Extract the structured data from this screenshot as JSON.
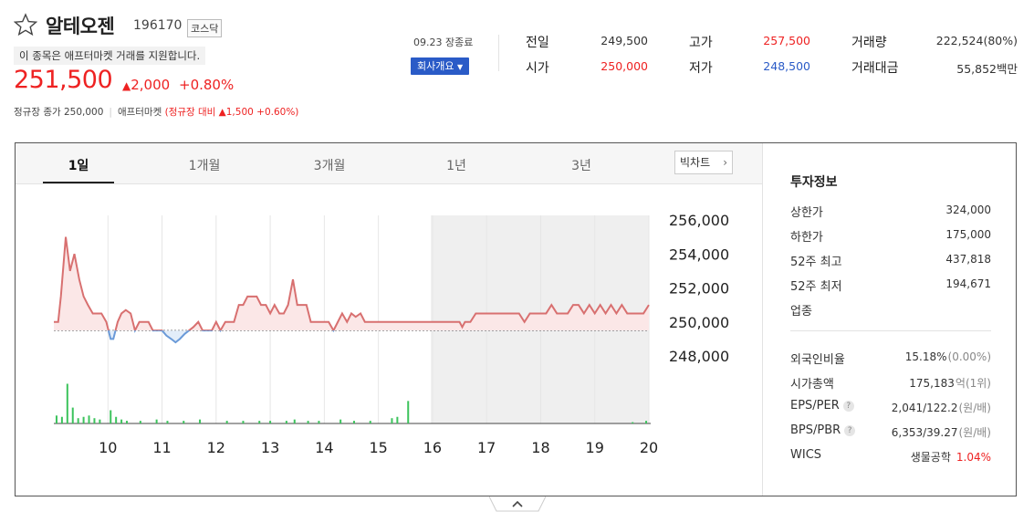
{
  "stock": {
    "name": "알테오젠",
    "code": "196170",
    "market": "코스닥",
    "notice": "이 종목은 애프터마켓 거래를 지원합니다.",
    "price": "251,500",
    "change_amount": "2,000",
    "change_percent": "+0.80%",
    "regular_close_label": "정규장 종가 250,000",
    "aftermarket_label": "애프터마켓",
    "aftermarket_compare": "(정규장 대비 ▲1,500 +0.60%)"
  },
  "header": {
    "date_status": "09.23 장종료",
    "company_button": "회사개요",
    "stats": [
      {
        "label": "전일",
        "value": "249,500",
        "tone": "normal"
      },
      {
        "label": "고가",
        "value": "257,500",
        "tone": "up"
      },
      {
        "label": "거래량",
        "value": "222,524(80%)",
        "tone": "normal"
      },
      {
        "label": "시가",
        "value": "250,000",
        "tone": "up"
      },
      {
        "label": "저가",
        "value": "248,500",
        "tone": "down"
      },
      {
        "label": "거래대금",
        "value": "55,852백만",
        "tone": "normal"
      }
    ]
  },
  "tabs": [
    {
      "label": "1일",
      "active": true
    },
    {
      "label": "1개월",
      "active": false
    },
    {
      "label": "3개월",
      "active": false
    },
    {
      "label": "1년",
      "active": false
    },
    {
      "label": "3년",
      "active": false
    }
  ],
  "big_chart_button": "빅차트",
  "chart_data": {
    "type": "line",
    "title": "",
    "x_ticks": [
      "10",
      "11",
      "12",
      "13",
      "14",
      "15",
      "16",
      "17",
      "18",
      "19",
      "20"
    ],
    "y_ticks": [
      "256,000",
      "254,000",
      "252,000",
      "250,000",
      "248,000"
    ],
    "ylim": [
      247500,
      257000
    ],
    "baseline": 249500,
    "shaded_from_hour": 15.97,
    "series": [
      {
        "hours": [
          9.0,
          9.08,
          9.13,
          9.22,
          9.3,
          9.38,
          9.47,
          9.55,
          9.63,
          9.72,
          9.8,
          9.88,
          9.97,
          10.05,
          10.1,
          10.18,
          10.25,
          10.33,
          10.42,
          10.5,
          10.58,
          10.67,
          10.75,
          10.83,
          10.92,
          11.0,
          11.08,
          11.17,
          11.25,
          11.33,
          11.42,
          11.5,
          11.58,
          11.67,
          11.75,
          11.83,
          11.92,
          12.0,
          12.08,
          12.17,
          12.25,
          12.33,
          12.42,
          12.5,
          12.58,
          12.67,
          12.75,
          12.83,
          12.92,
          13.0,
          13.08,
          13.17,
          13.25,
          13.33,
          13.42,
          13.5,
          13.58,
          13.67,
          13.75,
          13.83,
          13.92,
          14.0,
          14.08,
          14.17,
          14.25,
          14.33,
          14.42,
          14.5,
          14.58,
          14.67,
          14.75,
          14.83,
          14.92,
          15.0,
          15.08,
          15.17,
          15.25,
          15.33,
          15.42,
          15.5,
          15.58,
          15.67,
          15.75,
          15.83,
          15.92,
          16.0,
          16.1,
          16.2,
          16.3,
          16.4,
          16.5,
          16.55,
          16.6,
          16.7,
          16.8,
          16.9,
          17.0,
          17.1,
          17.2,
          17.3,
          17.4,
          17.5,
          17.6,
          17.7,
          17.8,
          17.9,
          18.0,
          18.1,
          18.2,
          18.3,
          18.4,
          18.5,
          18.6,
          18.7,
          18.8,
          18.9,
          19.0,
          19.1,
          19.2,
          19.3,
          19.4,
          19.5,
          19.6,
          19.7,
          19.8,
          19.9,
          20.0
        ],
        "values": [
          250000,
          250000,
          251500,
          255000,
          253000,
          254000,
          252500,
          251500,
          251000,
          250500,
          250500,
          250500,
          250000,
          249000,
          249000,
          250000,
          250500,
          250700,
          250500,
          249500,
          250000,
          250000,
          250000,
          249500,
          249500,
          249500,
          249200,
          249000,
          248800,
          249000,
          249300,
          249500,
          249700,
          250000,
          249500,
          249500,
          249500,
          250000,
          249500,
          250000,
          250000,
          250000,
          251000,
          251000,
          251500,
          251500,
          251500,
          251000,
          251000,
          250500,
          251000,
          250500,
          250500,
          251000,
          252500,
          251000,
          251000,
          251000,
          250000,
          250000,
          250000,
          250000,
          250000,
          249500,
          250000,
          250500,
          250000,
          250500,
          250300,
          250500,
          250000,
          250000,
          250000,
          250000,
          250000,
          250000,
          250000,
          250000,
          250000,
          250000,
          250000,
          250000,
          250000,
          250000,
          250000,
          250000,
          250000,
          250000,
          250000,
          250000,
          250000,
          249700,
          250000,
          250000,
          250500,
          250500,
          250500,
          250500,
          250500,
          250500,
          250500,
          250500,
          250500,
          250000,
          250500,
          250500,
          250500,
          250500,
          251000,
          250500,
          250500,
          250500,
          251000,
          251000,
          250500,
          251000,
          250500,
          251000,
          250500,
          251000,
          250500,
          251000,
          250500,
          250500,
          250500,
          250500,
          251000,
          250500,
          251500,
          251500
        ]
      }
    ],
    "volume": [
      {
        "hour": 9.05,
        "v": 6
      },
      {
        "hour": 9.15,
        "v": 5
      },
      {
        "hour": 9.25,
        "v": 30
      },
      {
        "hour": 9.35,
        "v": 12
      },
      {
        "hour": 9.45,
        "v": 4
      },
      {
        "hour": 9.55,
        "v": 5
      },
      {
        "hour": 9.65,
        "v": 6
      },
      {
        "hour": 9.75,
        "v": 4
      },
      {
        "hour": 9.85,
        "v": 3
      },
      {
        "hour": 10.05,
        "v": 10
      },
      {
        "hour": 10.15,
        "v": 5
      },
      {
        "hour": 10.25,
        "v": 3
      },
      {
        "hour": 10.35,
        "v": 2
      },
      {
        "hour": 10.6,
        "v": 2
      },
      {
        "hour": 10.9,
        "v": 3
      },
      {
        "hour": 11.1,
        "v": 2
      },
      {
        "hour": 11.4,
        "v": 2
      },
      {
        "hour": 11.7,
        "v": 3
      },
      {
        "hour": 12.2,
        "v": 2
      },
      {
        "hour": 12.5,
        "v": 2
      },
      {
        "hour": 12.8,
        "v": 2
      },
      {
        "hour": 13.0,
        "v": 2
      },
      {
        "hour": 13.3,
        "v": 2
      },
      {
        "hour": 13.45,
        "v": 3
      },
      {
        "hour": 13.7,
        "v": 2
      },
      {
        "hour": 13.9,
        "v": 2
      },
      {
        "hour": 14.3,
        "v": 3
      },
      {
        "hour": 14.55,
        "v": 2
      },
      {
        "hour": 14.85,
        "v": 2
      },
      {
        "hour": 15.25,
        "v": 4
      },
      {
        "hour": 15.35,
        "v": 5
      },
      {
        "hour": 15.55,
        "v": 17
      },
      {
        "hour": 19.7,
        "v": 1
      },
      {
        "hour": 19.95,
        "v": 2
      }
    ]
  },
  "info_panel": {
    "title": "투자정보",
    "rows": [
      {
        "label": "상한가",
        "value": "324,000",
        "tone": "up"
      },
      {
        "label": "하한가",
        "value": "175,000",
        "tone": "down"
      },
      {
        "label": "52주 최고",
        "value": "437,818",
        "tone": "normal"
      },
      {
        "label": "52주 최저",
        "value": "194,671",
        "tone": "normal"
      },
      {
        "label": "업종",
        "value": "",
        "tone": "normal"
      }
    ],
    "rows2": [
      {
        "label": "외국인비율",
        "value": "15.18%",
        "extra": "(0.00%)",
        "help": false
      },
      {
        "label": "시가총액",
        "value": "175,183",
        "extra": "억(1위)",
        "help": false
      },
      {
        "label": "EPS/PER",
        "value": "2,041/122.2",
        "extra": "(원/배)",
        "help": true
      },
      {
        "label": "BPS/PBR",
        "value": "6,353/39.27",
        "extra": "(원/배)",
        "help": true
      },
      {
        "label": "WICS",
        "value": "생물공학",
        "extra": "1.04%",
        "help": false
      }
    ]
  },
  "colors": {
    "up": "#e22222",
    "down": "#2a5bc7",
    "line_up": "#d87070",
    "line_down": "#6a9ad8",
    "volume": "#3cc35c",
    "fill_up": "#fbe7e7",
    "fill_down": "#e3edf9",
    "shade": "#efefef"
  }
}
